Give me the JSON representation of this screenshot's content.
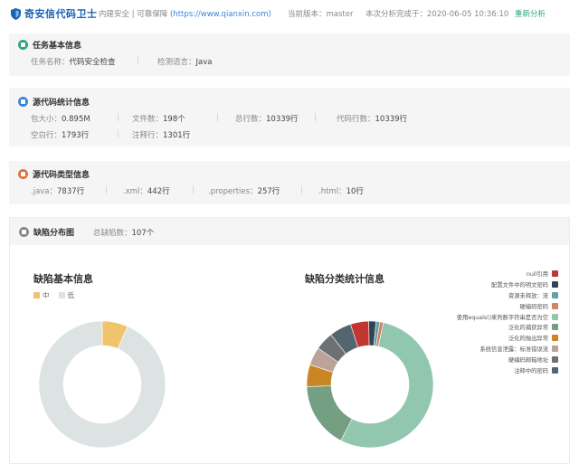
{
  "app": {
    "logo_text": "奇安信代码卫士",
    "slogan_prefix": "内建安全 | 可靠保障 ",
    "slogan_url": "(https://www.qianxin.com)",
    "version_label": "当前版本：",
    "version_value": "master",
    "analyzed_label": "本次分析完成于：",
    "analyzed_value": "2020-06-05 10:36:10",
    "reanalyze": "重新分析"
  },
  "task": {
    "title": "任务基本信息",
    "name_label": "任务名称：",
    "name_value": "代码安全检查",
    "lang_label": "检测语言：",
    "lang_value": "Java",
    "icon_color": "#2aa876"
  },
  "stats": {
    "title": "源代码统计信息",
    "icon_color": "#3a86d6",
    "items": [
      {
        "label": "包大小：",
        "value": "0.895M"
      },
      {
        "label": "文件数：",
        "value": "198个"
      },
      {
        "label": "总行数：",
        "value": "10339行"
      },
      {
        "label": "代码行数：",
        "value": "10339行"
      },
      {
        "label": "空白行：",
        "value": "1793行"
      },
      {
        "label": "注释行：",
        "value": "1301行"
      }
    ]
  },
  "types": {
    "title": "源代码类型信息",
    "icon_color": "#e07040",
    "items": [
      {
        "label": ".java：",
        "value": "7837行"
      },
      {
        "label": ".xml：",
        "value": "442行"
      },
      {
        "label": ".properties：",
        "value": "257行"
      },
      {
        "label": ".html：",
        "value": "10行"
      }
    ]
  },
  "defect": {
    "title": "缺陷分布图",
    "total_label": "总缺陷数：",
    "total_value": "107个",
    "icon_color": "#888888"
  },
  "chart_data": [
    {
      "type": "pie",
      "title": "缺陷基本信息",
      "categories": [
        "中",
        "低"
      ],
      "values": [
        7,
        100
      ],
      "colors": [
        "#f0c36d",
        "#dde3e3"
      ],
      "legend": "top-left"
    },
    {
      "type": "pie",
      "title": "缺陷分类统计信息",
      "categories": [
        "null引用",
        "配置文件中的明文密码",
        "资源未释放：流",
        "硬编码密码",
        "使用equals()来判断字符串是否为空",
        "泛化的捕获异常",
        "泛化的抛出异常",
        "系统信息泄露：标准错误流",
        "硬编码邮箱地址",
        "注释中的密码"
      ],
      "values": [
        5,
        2,
        1,
        1,
        58,
        18,
        6,
        5,
        5,
        6
      ],
      "colors": [
        "#c23531",
        "#2f4554",
        "#61a0a8",
        "#d48265",
        "#91c7ae",
        "#749f83",
        "#ca8622",
        "#bda29a",
        "#6e7074",
        "#546570"
      ],
      "legend": "right"
    }
  ]
}
